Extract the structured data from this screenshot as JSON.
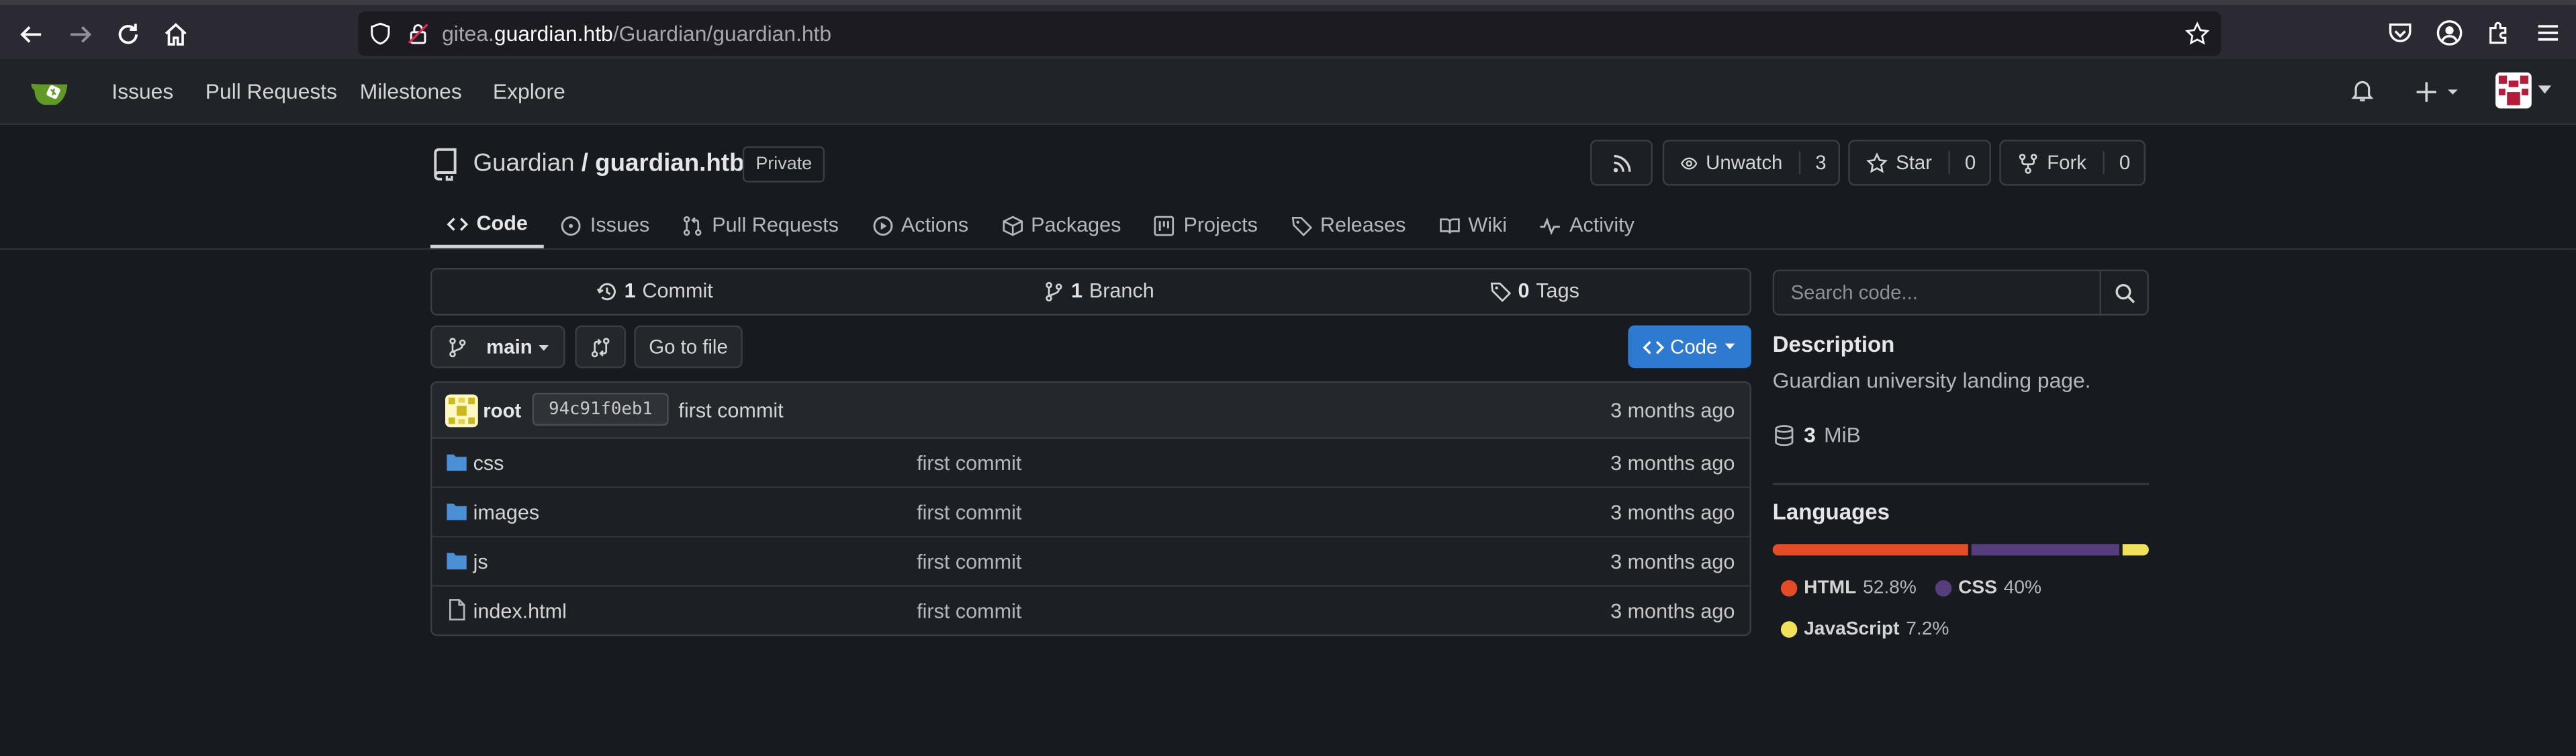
{
  "browser": {
    "url_host_prefix": "gitea.",
    "url_host": "guardian.htb",
    "url_path": "/Guardian/guardian.htb"
  },
  "topnav": {
    "links": [
      "Issues",
      "Pull Requests",
      "Milestones",
      "Explore"
    ]
  },
  "repo": {
    "owner": "Guardian",
    "separator": "/",
    "name": "guardian.htb",
    "visibility": "Private",
    "unwatch_label": "Unwatch",
    "watch_count": "3",
    "star_label": "Star",
    "star_count": "0",
    "fork_label": "Fork",
    "fork_count": "0"
  },
  "tabs": [
    {
      "label": "Code",
      "icon": "code-icon",
      "active": true
    },
    {
      "label": "Issues",
      "icon": "issue-icon"
    },
    {
      "label": "Pull Requests",
      "icon": "pull-request-icon"
    },
    {
      "label": "Actions",
      "icon": "play-icon"
    },
    {
      "label": "Packages",
      "icon": "package-icon"
    },
    {
      "label": "Projects",
      "icon": "project-icon"
    },
    {
      "label": "Releases",
      "icon": "tag-icon"
    },
    {
      "label": "Wiki",
      "icon": "book-icon"
    },
    {
      "label": "Activity",
      "icon": "pulse-icon"
    }
  ],
  "stats": {
    "commits_count": "1",
    "commits_label": "Commit",
    "branches_count": "1",
    "branches_label": "Branch",
    "tags_count": "0",
    "tags_label": "Tags"
  },
  "toolbar": {
    "branch": "main",
    "go_to_file": "Go to file",
    "code_button": "Code"
  },
  "latest_commit": {
    "author": "root",
    "sha": "94c91f0eb1",
    "message": "first commit",
    "age": "3 months ago"
  },
  "files": [
    {
      "name": "css",
      "type": "folder",
      "message": "first commit",
      "age": "3 months ago"
    },
    {
      "name": "images",
      "type": "folder",
      "message": "first commit",
      "age": "3 months ago"
    },
    {
      "name": "js",
      "type": "folder",
      "message": "first commit",
      "age": "3 months ago"
    },
    {
      "name": "index.html",
      "type": "file",
      "message": "first commit",
      "age": "3 months ago"
    }
  ],
  "sidebar": {
    "search_placeholder": "Search code...",
    "description_heading": "Description",
    "description": "Guardian university landing page.",
    "size_value": "3",
    "size_unit": "MiB",
    "languages_heading": "Languages",
    "languages": [
      {
        "name": "HTML",
        "percent": "52.8%",
        "share": 52.8,
        "color": "#e34c26"
      },
      {
        "name": "CSS",
        "percent": "40%",
        "share": 40,
        "color": "#563d7c"
      },
      {
        "name": "JavaScript",
        "percent": "7.2%",
        "share": 7.2,
        "color": "#f1e05a"
      }
    ]
  },
  "colors": {
    "accent": "#2f7ad1",
    "background": "#171a1e",
    "folder": "#4b8fd6"
  }
}
